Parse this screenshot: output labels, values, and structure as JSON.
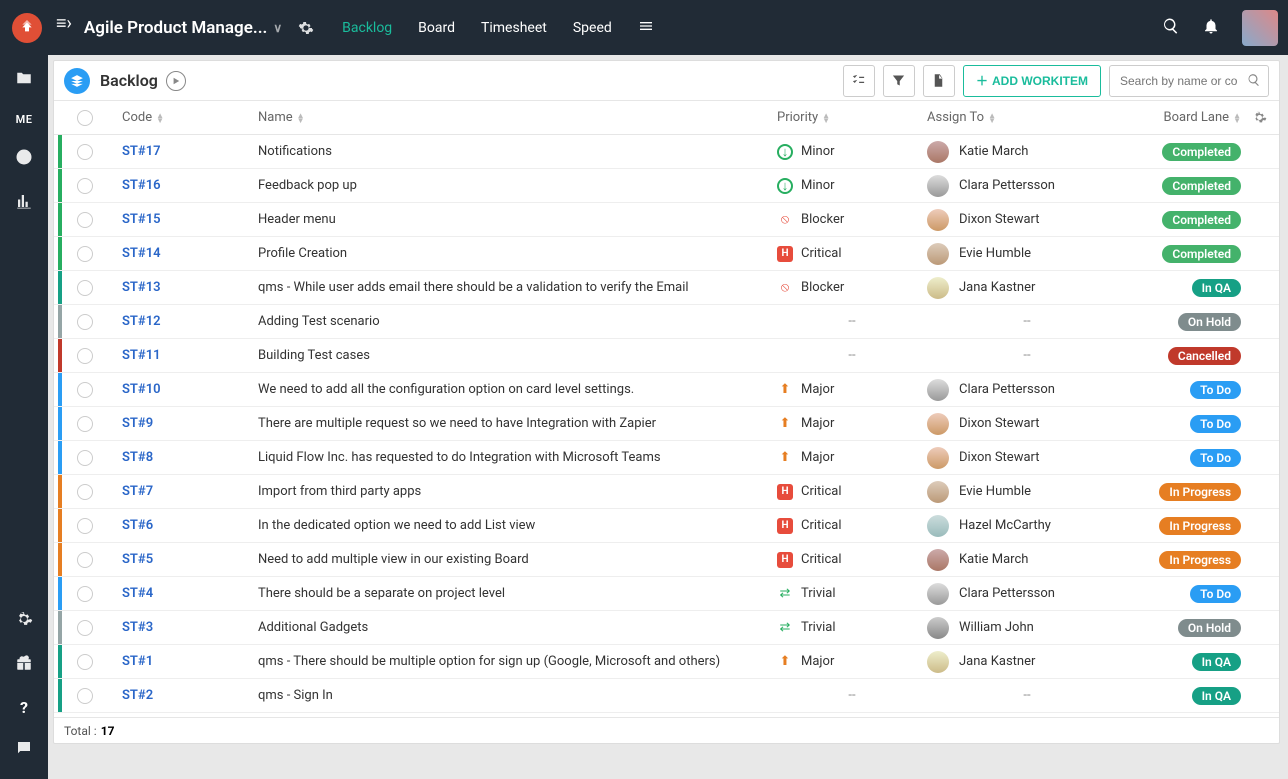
{
  "header": {
    "project_title": "Agile Product Manage...",
    "tabs": [
      "Backlog",
      "Board",
      "Timesheet",
      "Speed"
    ],
    "active_tab": 0
  },
  "leftrail": {
    "me": "ME"
  },
  "panel": {
    "title": "Backlog",
    "add_label": "ADD WORKITEM",
    "search_placeholder": "Search by name or co"
  },
  "columns": {
    "code": "Code",
    "name": "Name",
    "priority": "Priority",
    "assign": "Assign To",
    "lane": "Board Lane"
  },
  "footer": {
    "label": "Total :",
    "count": "17"
  },
  "priority_icons": {
    "Minor": {
      "cls": "prio-minor",
      "glyph": "↓"
    },
    "Major": {
      "cls": "prio-major-up",
      "glyph": "⬆"
    },
    "Blocker": {
      "cls": "prio-blocker",
      "glyph": "⦸"
    },
    "Critical": {
      "cls": "prio-critical",
      "glyph": "H"
    },
    "Trivial": {
      "cls": "prio-trivial",
      "glyph": "⇄"
    }
  },
  "lane_class": {
    "Completed": "lane-Completed",
    "In QA": "lane-InQA",
    "On Hold": "lane-OnHold",
    "Cancelled": "lane-Cancelled",
    "To Do": "lane-ToDo",
    "In Progress": "lane-InProgress"
  },
  "rows": [
    {
      "stripe": "s-green",
      "code": "ST#17",
      "name": "Notifications",
      "priority": "Minor",
      "assignee": "Katie March",
      "av": "av1",
      "lane": "Completed"
    },
    {
      "stripe": "s-green",
      "code": "ST#16",
      "name": "Feedback pop up",
      "priority": "Minor",
      "assignee": "Clara Pettersson",
      "av": "av2",
      "lane": "Completed"
    },
    {
      "stripe": "s-green",
      "code": "ST#15",
      "name": "Header menu",
      "priority": "Blocker",
      "assignee": "Dixon Stewart",
      "av": "av3",
      "lane": "Completed"
    },
    {
      "stripe": "s-green",
      "code": "ST#14",
      "name": "Profile Creation",
      "priority": "Critical",
      "assignee": "Evie Humble",
      "av": "av4",
      "lane": "Completed"
    },
    {
      "stripe": "s-teal",
      "code": "ST#13",
      "name": "qms - While user adds email there should be a validation to verify the Email",
      "priority": "Blocker",
      "assignee": "Jana Kastner",
      "av": "av5",
      "lane": "In QA"
    },
    {
      "stripe": "s-gray",
      "code": "ST#12",
      "name": "Adding Test scenario",
      "priority": "--",
      "assignee": "--",
      "av": "",
      "lane": "On Hold"
    },
    {
      "stripe": "s-red",
      "code": "ST#11",
      "name": "Building Test cases",
      "priority": "--",
      "assignee": "--",
      "av": "",
      "lane": "Cancelled"
    },
    {
      "stripe": "s-blue",
      "code": "ST#10",
      "name": "We need to add all the configuration option on card level settings.",
      "priority": "Major",
      "assignee": "Clara Pettersson",
      "av": "av2",
      "lane": "To Do"
    },
    {
      "stripe": "s-blue",
      "code": "ST#9",
      "name": "There are multiple request so we need to have Integration with Zapier",
      "priority": "Major",
      "assignee": "Dixon Stewart",
      "av": "av3",
      "lane": "To Do"
    },
    {
      "stripe": "s-blue",
      "code": "ST#8",
      "name": "Liquid Flow Inc. has requested to do Integration with Microsoft Teams",
      "priority": "Major",
      "assignee": "Dixon Stewart",
      "av": "av3",
      "lane": "To Do"
    },
    {
      "stripe": "s-orange",
      "code": "ST#7",
      "name": "Import from third party apps",
      "priority": "Critical",
      "assignee": "Evie Humble",
      "av": "av4",
      "lane": "In Progress"
    },
    {
      "stripe": "s-orange",
      "code": "ST#6",
      "name": "In the dedicated option we need to add List view",
      "priority": "Critical",
      "assignee": "Hazel McCarthy",
      "av": "av6",
      "lane": "In Progress"
    },
    {
      "stripe": "s-orange",
      "code": "ST#5",
      "name": "Need to add multiple view in our existing Board",
      "priority": "Critical",
      "assignee": "Katie March",
      "av": "av1",
      "lane": "In Progress"
    },
    {
      "stripe": "s-blue",
      "code": "ST#4",
      "name": "There should be a separate on project level",
      "priority": "Trivial",
      "assignee": "Clara Pettersson",
      "av": "av2",
      "lane": "To Do"
    },
    {
      "stripe": "s-gray",
      "code": "ST#3",
      "name": "Additional Gadgets",
      "priority": "Trivial",
      "assignee": "William John",
      "av": "av7",
      "lane": "On Hold"
    },
    {
      "stripe": "s-teal",
      "code": "ST#1",
      "name": "qms - There should be multiple option for sign up (Google, Microsoft and others)",
      "priority": "Major",
      "assignee": "Jana Kastner",
      "av": "av5",
      "lane": "In QA"
    },
    {
      "stripe": "s-teal",
      "code": "ST#2",
      "name": "qms - Sign In",
      "priority": "--",
      "assignee": "--",
      "av": "",
      "lane": "In QA"
    }
  ]
}
